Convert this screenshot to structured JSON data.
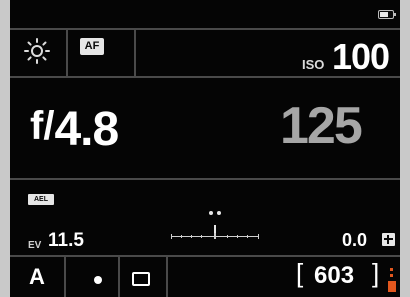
{
  "status": {
    "battery_icon": "battery-icon"
  },
  "row1": {
    "wb_icon": "sun-icon",
    "af_label": "AF",
    "iso_label": "ISO",
    "iso_value": "100"
  },
  "exposure": {
    "aperture_prefix": "f/",
    "aperture_value": "4.8",
    "shutter_value": "125"
  },
  "row3": {
    "ael_label": "AEL",
    "ev_label": "EV",
    "ev_value": "11.5",
    "meter_icon": "exposure-meter-icon",
    "comp_value": "0.0",
    "comp_icon": "exposure-comp-icon"
  },
  "bottom": {
    "mode": "A",
    "drive_icon": "single-shot-icon",
    "frame_icon": "frame-icon",
    "bracket_left": "[",
    "shots_remaining": "603",
    "bracket_right": "]",
    "card_icon": "card-icon"
  },
  "colors": {
    "background": "#050505",
    "text": "#ffffff",
    "dim_text": "#a6a6a6",
    "accent": "#e2571e"
  }
}
